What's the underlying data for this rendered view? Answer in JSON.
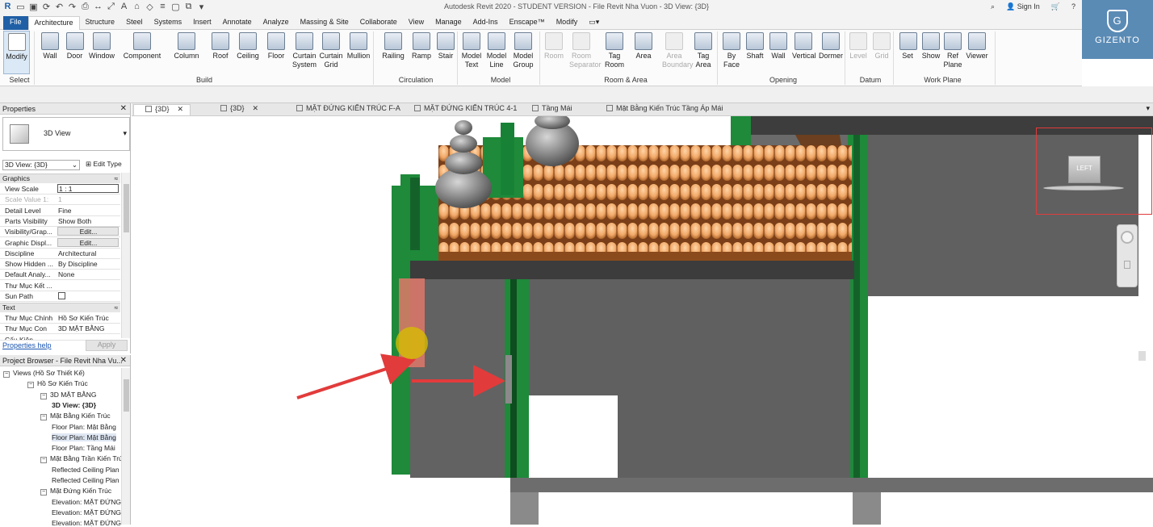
{
  "title_bar": {
    "title": "Autodesk Revit 2020 - STUDENT VERSION - File Revit Nha Vuon - 3D View: {3D}",
    "sign_in": "Sign In"
  },
  "ribbon_tabs": [
    "File",
    "Architecture",
    "Structure",
    "Steel",
    "Systems",
    "Insert",
    "Annotate",
    "Analyze",
    "Massing & Site",
    "Collaborate",
    "View",
    "Manage",
    "Add-Ins",
    "Enscape™",
    "Modify"
  ],
  "ribbon": {
    "buttons": [
      {
        "label": "Modify",
        "icon": "cursor-arrow-icon"
      },
      {
        "label": "Wall",
        "icon": "wall-icon"
      },
      {
        "label": "Door",
        "icon": "door-icon"
      },
      {
        "label": "Window",
        "icon": "window-icon"
      },
      {
        "label": "Component",
        "icon": "component-icon"
      },
      {
        "label": "Column",
        "icon": "column-icon"
      },
      {
        "label": "Roof",
        "icon": "roof-icon"
      },
      {
        "label": "Ceiling",
        "icon": "ceiling-icon"
      },
      {
        "label": "Floor",
        "icon": "floor-icon"
      },
      {
        "label": "Curtain System",
        "icon": "curtain-system-icon"
      },
      {
        "label": "Curtain Grid",
        "icon": "curtain-grid-icon"
      },
      {
        "label": "Mullion",
        "icon": "mullion-icon"
      },
      {
        "label": "Railing",
        "icon": "railing-icon"
      },
      {
        "label": "Ramp",
        "icon": "ramp-icon"
      },
      {
        "label": "Stair",
        "icon": "stair-icon"
      },
      {
        "label": "Model Text",
        "icon": "model-text-icon"
      },
      {
        "label": "Model Line",
        "icon": "model-line-icon"
      },
      {
        "label": "Model Group",
        "icon": "model-group-icon"
      },
      {
        "label": "Room",
        "icon": "room-icon"
      },
      {
        "label": "Room Separator",
        "icon": "room-separator-icon"
      },
      {
        "label": "Tag Room",
        "icon": "tag-room-icon"
      },
      {
        "label": "Area",
        "icon": "area-icon"
      },
      {
        "label": "Area Boundary",
        "icon": "area-boundary-icon"
      },
      {
        "label": "Tag Area",
        "icon": "tag-area-icon"
      },
      {
        "label": "By Face",
        "icon": "by-face-icon"
      },
      {
        "label": "Shaft",
        "icon": "shaft-icon"
      },
      {
        "label": "Wall",
        "icon": "wall-opening-icon"
      },
      {
        "label": "Vertical",
        "icon": "vertical-opening-icon"
      },
      {
        "label": "Dormer",
        "icon": "dormer-icon"
      },
      {
        "label": "Level",
        "icon": "level-icon"
      },
      {
        "label": "Grid",
        "icon": "grid-icon"
      },
      {
        "label": "Set",
        "icon": "set-workplane-icon"
      },
      {
        "label": "Show",
        "icon": "show-workplane-icon"
      },
      {
        "label": "Ref Plane",
        "icon": "ref-plane-icon"
      },
      {
        "label": "Viewer",
        "icon": "viewer-icon"
      }
    ],
    "panels": [
      "Select",
      "Build",
      "Circulation",
      "Model",
      "Room & Area",
      "Opening",
      "Datum",
      "Work Plane"
    ]
  },
  "logo_text": "GIZENTO",
  "logo_letter": "G",
  "view_tabs": [
    "{3D}",
    "{3D}",
    "MẶT ĐỨNG KIẾN TRÚC F-A",
    "MẶT ĐỨNG KIẾN TRÚC 4-1",
    "Tầng Mái",
    "Mặt Bằng Kiến Trúc Tầng Áp Mái"
  ],
  "properties": {
    "header": "Properties",
    "type_name": "3D View",
    "view_selector": "3D View: {3D}",
    "edit_type": "Edit Type",
    "section_graphics": "Graphics",
    "rows": [
      {
        "k": "View Scale",
        "v": "1 : 1"
      },
      {
        "k": "Scale Value    1:",
        "v": "1"
      },
      {
        "k": "Detail Level",
        "v": "Fine"
      },
      {
        "k": "Parts Visibility",
        "v": "Show Both"
      },
      {
        "k": "Visibility/Grap...",
        "v": "Edit..."
      },
      {
        "k": "Graphic Displ...",
        "v": "Edit..."
      },
      {
        "k": "Discipline",
        "v": "Architectural"
      },
      {
        "k": "Show Hidden ...",
        "v": "By Discipline"
      },
      {
        "k": "Default Analy...",
        "v": "None"
      },
      {
        "k": "Thư Mục Kết ...",
        "v": ""
      },
      {
        "k": "Sun Path",
        "v": ""
      }
    ],
    "section_text": "Text",
    "rows2": [
      {
        "k": "Thư Mục Chính",
        "v": "Hồ Sơ Kiến Trúc"
      },
      {
        "k": "Thư Mục Con",
        "v": "3D MẶT BẰNG"
      },
      {
        "k": "Cấu Kiện",
        "v": ""
      }
    ],
    "help": "Properties help",
    "apply": "Apply"
  },
  "project_browser": {
    "header": "Project Browser - File Revit Nha Vu...",
    "nodes": [
      "Views (Hồ Sơ Thiết Kế)",
      "Hồ Sơ Kiến Trúc",
      "3D MẶT BẰNG",
      "3D View: {3D}",
      "Mặt Bằng Kiến Trúc",
      "Floor Plan: Mặt Bằng",
      "Floor Plan: Mặt Bằng",
      "Floor Plan: Tầng Mái",
      "Mặt Bằng Trần Kiến Trúc",
      "Reflected Ceiling Plan",
      "Reflected Ceiling Plan",
      "Mặt Đứng Kiến Trúc",
      "Elevation: MẶT ĐỨNG",
      "Elevation: MẶT ĐỨNG",
      "Elevation: MẶT ĐỨNG"
    ]
  },
  "viewcube_face": "LEFT",
  "colors": {
    "accent_blue": "#1f5fa6",
    "annotation_red": "#e23b3b",
    "roof_tile": "#f0a868",
    "wall_green": "#1e8a3a",
    "model_gray": "#5d5d5d"
  }
}
